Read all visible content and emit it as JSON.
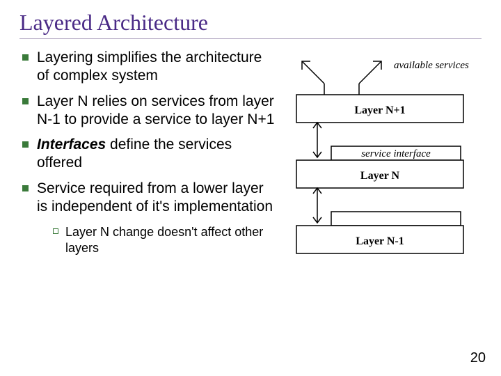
{
  "title": "Layered Architecture",
  "bullets": [
    {
      "text": "Layering simplifies the architecture of complex system"
    },
    {
      "text": "Layer N relies on services from layer N-1 to provide a service to layer N+1"
    },
    {
      "text_pre": "Interfaces",
      "text_post": " define the services offered",
      "emphasis": true
    },
    {
      "text": "Service required from a lower layer is independent of it's implementation"
    }
  ],
  "sub_bullets": [
    {
      "text": "Layer N change doesn't affect other layers"
    }
  ],
  "diagram": {
    "top_label": "available services",
    "layer_top": "Layer N+1",
    "mid_label": "service interface",
    "layer_mid": "Layer N",
    "layer_bot": "Layer N-1"
  },
  "page_number": "20"
}
